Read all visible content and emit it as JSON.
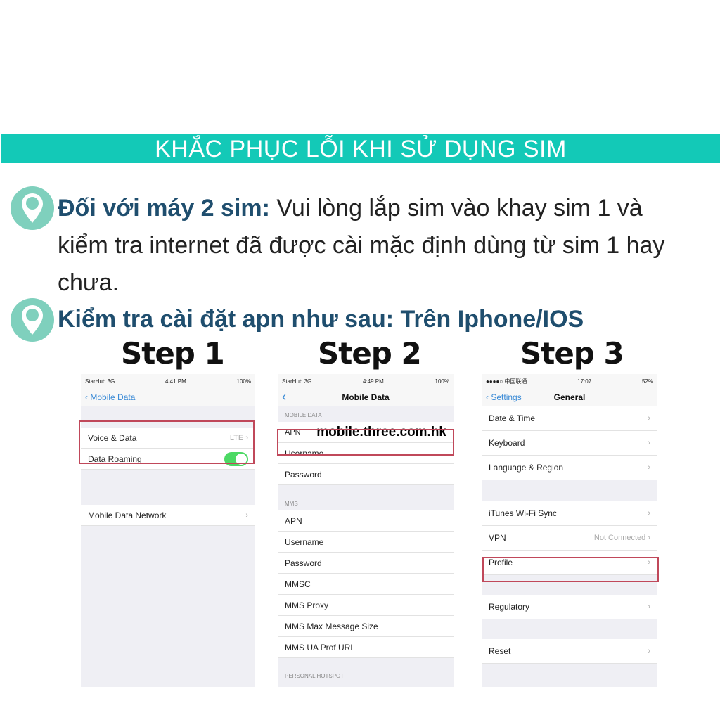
{
  "banner": "KHẮC PHỤC LỖI KHI SỬ DỤNG SIM",
  "tip1": {
    "bold": "Đối với máy 2 sim:",
    "text": " Vui lòng lắp sim vào khay sim 1 và kiểm tra internet đã được cài mặc định dùng từ sim 1 hay chưa."
  },
  "tip2": {
    "bold": "Kiểm tra cài đặt apn như sau: Trên Iphone/IOS"
  },
  "colors": {
    "banner": "#13c9b7",
    "pin": "#7fd0bd",
    "heading": "#1f4e6e",
    "highlight": "#c0485a"
  },
  "steps": [
    {
      "label": "Step 1",
      "status": {
        "left": "StarHub 3G",
        "time": "4:41 PM",
        "right": "100%"
      },
      "back": "Mobile Data",
      "title": "",
      "rows": [
        {
          "label": "Voice & Data",
          "value": "LTE"
        },
        {
          "label": "Data Roaming",
          "toggle": true
        }
      ],
      "rows2": [
        {
          "label": "Mobile Data Network"
        }
      ]
    },
    {
      "label": "Step 2",
      "status": {
        "left": "StarHub 3G",
        "time": "4:49 PM",
        "right": "100%"
      },
      "back": "",
      "title": "Mobile Data",
      "section1": "MOBILE DATA",
      "rows": [
        {
          "label": "APN",
          "value": "mobile.three.com.hk"
        },
        {
          "label": "Username"
        },
        {
          "label": "Password"
        }
      ],
      "section2": "MMS",
      "rows2": [
        {
          "label": "APN"
        },
        {
          "label": "Username"
        },
        {
          "label": "Password"
        },
        {
          "label": "MMSC"
        },
        {
          "label": "MMS Proxy"
        },
        {
          "label": "MMS Max Message Size"
        },
        {
          "label": "MMS UA Prof URL"
        }
      ],
      "section3": "PERSONAL HOTSPOT"
    },
    {
      "label": "Step 3",
      "status": {
        "left": "●●●●○ 中国联通",
        "time": "17:07",
        "right": "52%"
      },
      "back": "Settings",
      "title": "General",
      "rows": [
        {
          "label": "Date & Time"
        },
        {
          "label": "Keyboard"
        },
        {
          "label": "Language & Region"
        }
      ],
      "rows2": [
        {
          "label": "iTunes Wi-Fi Sync"
        },
        {
          "label": "VPN",
          "value": "Not Connected"
        }
      ],
      "rows3": [
        {
          "label": "Profile"
        }
      ],
      "rows4": [
        {
          "label": "Regulatory"
        }
      ],
      "rows5": [
        {
          "label": "Reset"
        }
      ]
    }
  ]
}
